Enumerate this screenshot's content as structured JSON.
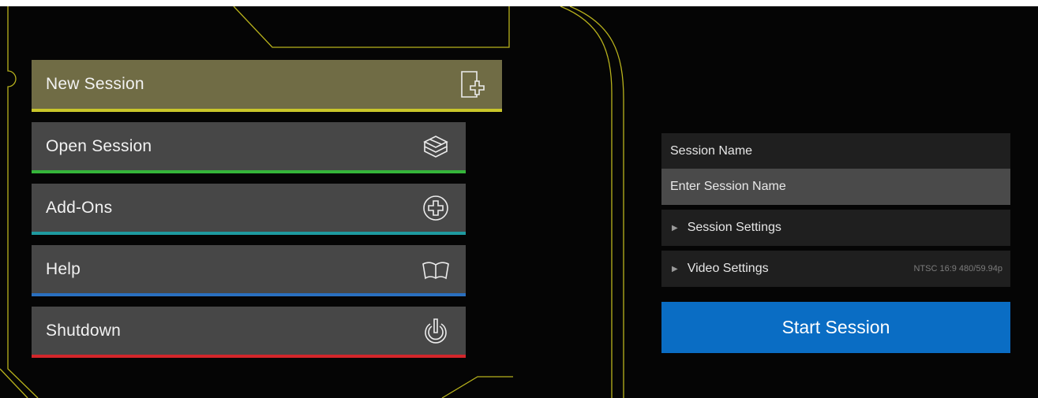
{
  "menu": {
    "items": [
      {
        "label": "New Session",
        "icon": "new-session-icon",
        "accent": "#c9c62a",
        "active": true
      },
      {
        "label": "Open Session",
        "icon": "open-box-icon",
        "accent": "#35b53a",
        "active": false
      },
      {
        "label": "Add-Ons",
        "icon": "plus-circle-icon",
        "accent": "#1f9aa0",
        "active": false
      },
      {
        "label": "Help",
        "icon": "open-book-icon",
        "accent": "#2a6fbf",
        "active": false
      },
      {
        "label": "Shutdown",
        "icon": "power-icon",
        "accent": "#d3262b",
        "active": false
      }
    ]
  },
  "session_panel": {
    "name_label": "Session Name",
    "name_placeholder": "Enter Session Name",
    "session_settings_label": "Session Settings",
    "video_settings_label": "Video Settings",
    "video_format": "NTSC 16:9 480/59.94p",
    "start_label": "Start Session",
    "start_color": "#0a6dc4"
  },
  "theme": {
    "background": "#050505",
    "circuit_line": "#b8b21c"
  }
}
